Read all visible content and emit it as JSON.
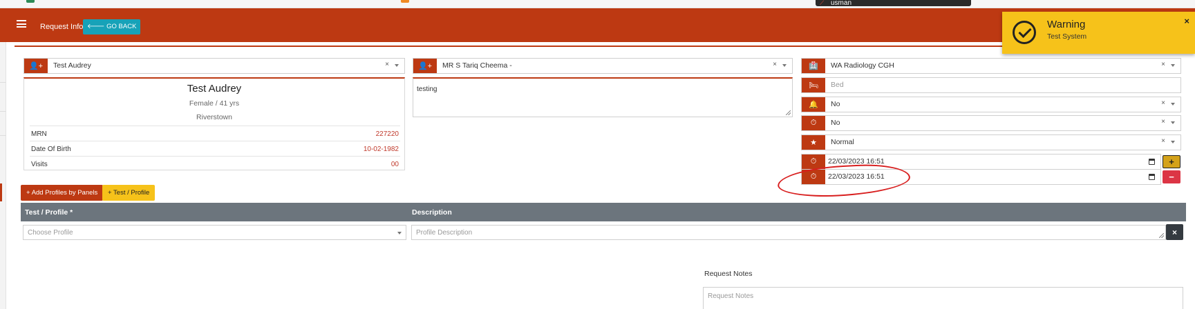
{
  "browser_strip": {
    "tab_text": "usman"
  },
  "header": {
    "menu_icon": "hamburger-icon",
    "title": "Request Info",
    "go_back_label": "GO BACK",
    "go_back_icon": "arrow-left-icon",
    "color": "#bd3912"
  },
  "patient_select": {
    "value": "Test Audrey",
    "clear": "×",
    "icon": "user-plus-icon"
  },
  "patient_card": {
    "name": "Test Audrey",
    "gender_age": "Female / 41 yrs",
    "town": "Riverstown",
    "rows": [
      {
        "label": "MRN",
        "value": "227220"
      },
      {
        "label": "Date Of Birth",
        "value": "10-02-1982"
      },
      {
        "label": "Visits",
        "value": "00"
      }
    ]
  },
  "doctor_select": {
    "value": "MR S Tariq Cheema -",
    "clear": "×",
    "icon": "user-plus-icon"
  },
  "clinical_notes": {
    "value": "testing"
  },
  "right_fields": {
    "location": {
      "value": "WA Radiology CGH",
      "clear": "×",
      "icon": "hospital-icon"
    },
    "bed": {
      "placeholder": "Bed",
      "icon": "bed-icon"
    },
    "field3": {
      "value": "No",
      "clear": "×",
      "icon": "bell-icon"
    },
    "field4": {
      "value": "No",
      "clear": "×",
      "icon": "clock-icon"
    },
    "priority": {
      "value": "Normal",
      "clear": "×",
      "icon": "star-icon"
    },
    "date1": {
      "value": "22/03/2023 16:51",
      "icon": "clock-icon",
      "add_label": "+"
    },
    "date2": {
      "value": "22/03/2023 16:51",
      "icon": "clock-icon",
      "remove_label": "−"
    }
  },
  "actions": {
    "add_profiles_label": "Add Profiles by Panels",
    "test_profile_label": "Test / Profile",
    "plus": "+"
  },
  "grid": {
    "columns": [
      "Test / Profile *",
      "Description"
    ],
    "profile_placeholder": "Choose Profile",
    "description_placeholder": "Profile Description",
    "remove_label": "×"
  },
  "request_notes": {
    "label": "Request Notes",
    "placeholder": "Request Notes"
  },
  "toast": {
    "title": "Warning",
    "message": "Test System",
    "close": "×",
    "icon": "check-circle-icon",
    "color": "#f6c21a"
  }
}
